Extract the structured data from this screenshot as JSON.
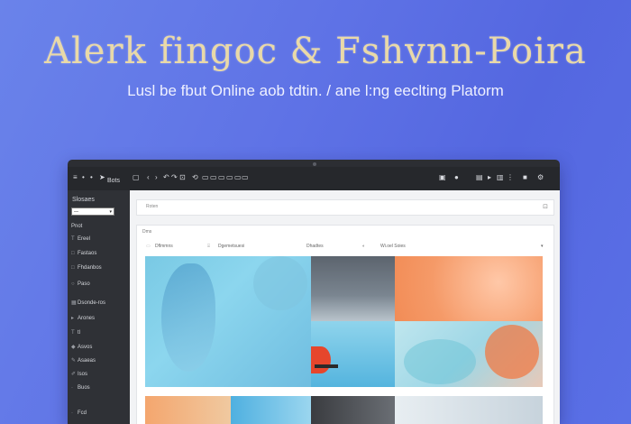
{
  "hero": {
    "title": "Alerk fingoc & Fshvnn-Poira",
    "subtitle": "Lusl be fbut  Online aob tdtin. / ane l:ng eeclting Platorm"
  },
  "colors": {
    "background": "#5f73e6",
    "title": "#e9d9a8",
    "laptop_frame": "#2c2e33",
    "sidebar": "#2f3136"
  },
  "toolbar": {
    "left_icons": [
      "menu-icon",
      "back-icon",
      "undo-icon",
      "redo-icon"
    ],
    "right_icons": [
      "cart-icon",
      "bell-icon",
      "grid-icon",
      "user-icon",
      "more-icon"
    ]
  },
  "sidebar": {
    "header": "Slosaes",
    "header_right": "Bots",
    "select_value": "—",
    "items": [
      {
        "label": "Pnot",
        "icon": ""
      },
      {
        "label": "Ereel",
        "icon": "text-icon"
      },
      {
        "label": "Fastaos",
        "icon": "square-icon"
      },
      {
        "label": "Fhdanbos",
        "icon": "square-icon"
      },
      {
        "label": "Paso",
        "icon": "circle-icon"
      },
      {
        "label": "Dsonde-ros",
        "icon": "grid-icon"
      },
      {
        "label": "Arones",
        "icon": "play-icon"
      },
      {
        "label": "tl",
        "icon": "text-icon"
      },
      {
        "label": "Asvos",
        "icon": "diamond-icon"
      },
      {
        "label": "Asaeas",
        "icon": "pencil-icon"
      },
      {
        "label": "Isos",
        "icon": "pen-icon"
      },
      {
        "label": "Buos",
        "icon": ""
      },
      {
        "label": "Fcd",
        "icon": ""
      }
    ]
  },
  "main": {
    "top_panel_label": "Roten",
    "panel_header": "Dms",
    "filters": [
      "Dflmmns",
      "Dgemetsuesi",
      "Dhadtes",
      "Wi.oel Soies"
    ]
  }
}
